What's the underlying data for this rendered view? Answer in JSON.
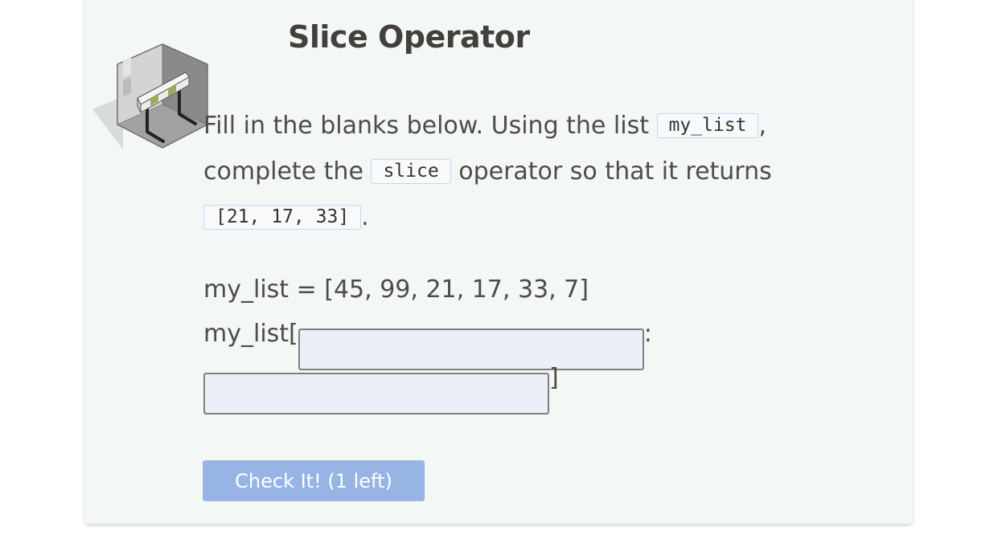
{
  "exercise": {
    "title": "Slice Operator",
    "prompt": {
      "part1": "Fill in the blanks below. Using the list ",
      "code_list_name": "my_list",
      "part2": ",",
      "part3": "complete the ",
      "code_slice": "slice",
      "part4": " operator so that it returns",
      "code_result": "[21, 17, 33]",
      "part5": "."
    },
    "code": {
      "line1": "my_list = [45, 99, 21, 17, 33, 7]",
      "line2_prefix": "my_list[",
      "colon": ":",
      "closing_bracket": "]",
      "start_value": "",
      "stop_value": ""
    },
    "check_button_label": "Check It! (1 left)"
  },
  "colors": {
    "card_background": "#f3f7f5",
    "button_background": "#97b4e4",
    "blank_background": "#eceff8"
  },
  "icons": {
    "illustration": "hurdle-room-illustration"
  }
}
